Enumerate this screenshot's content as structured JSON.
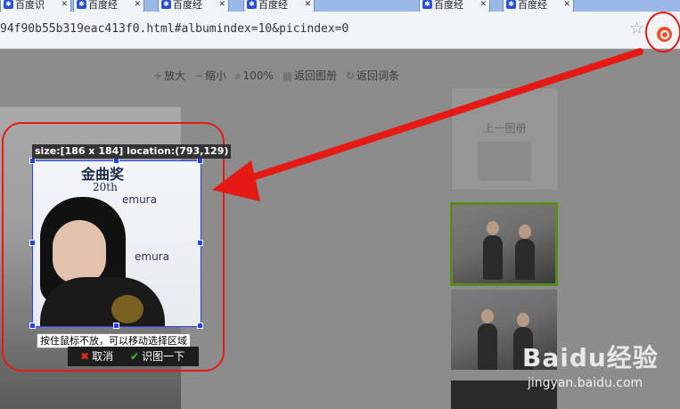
{
  "browser": {
    "tabs": [
      {
        "label": "百度识"
      },
      {
        "label": "百度经"
      },
      {
        "label": "百度经"
      },
      {
        "label": "百度经"
      },
      {
        "label": "百度经"
      },
      {
        "label": "百度经"
      }
    ],
    "url": "94f90b55b319eac413f0.html#albumindex=10&picindex=0"
  },
  "toolbar": {
    "zoom_in": "放大",
    "zoom_out": "缩小",
    "zoom_level": "100%",
    "back_album": "返回图册",
    "back_entry": "返回词条"
  },
  "sidebar": {
    "prev_album": "上一图册"
  },
  "selection": {
    "info": "size:[186 x 184] location:(793,129)",
    "hint": "按住鼠标不放，可以移动选择区域",
    "cancel": "取消",
    "identify": "识图一下"
  },
  "photo": {
    "logo": "金曲奖",
    "sub": "20th",
    "watermark": "emura"
  },
  "brand": {
    "logo_text": "Baidu经验",
    "url": "jingyan.baidu.com"
  },
  "colors": {
    "highlight_red": "#e51a14",
    "selection_blue": "#2040ff",
    "accent_green": "#4ec12f"
  }
}
